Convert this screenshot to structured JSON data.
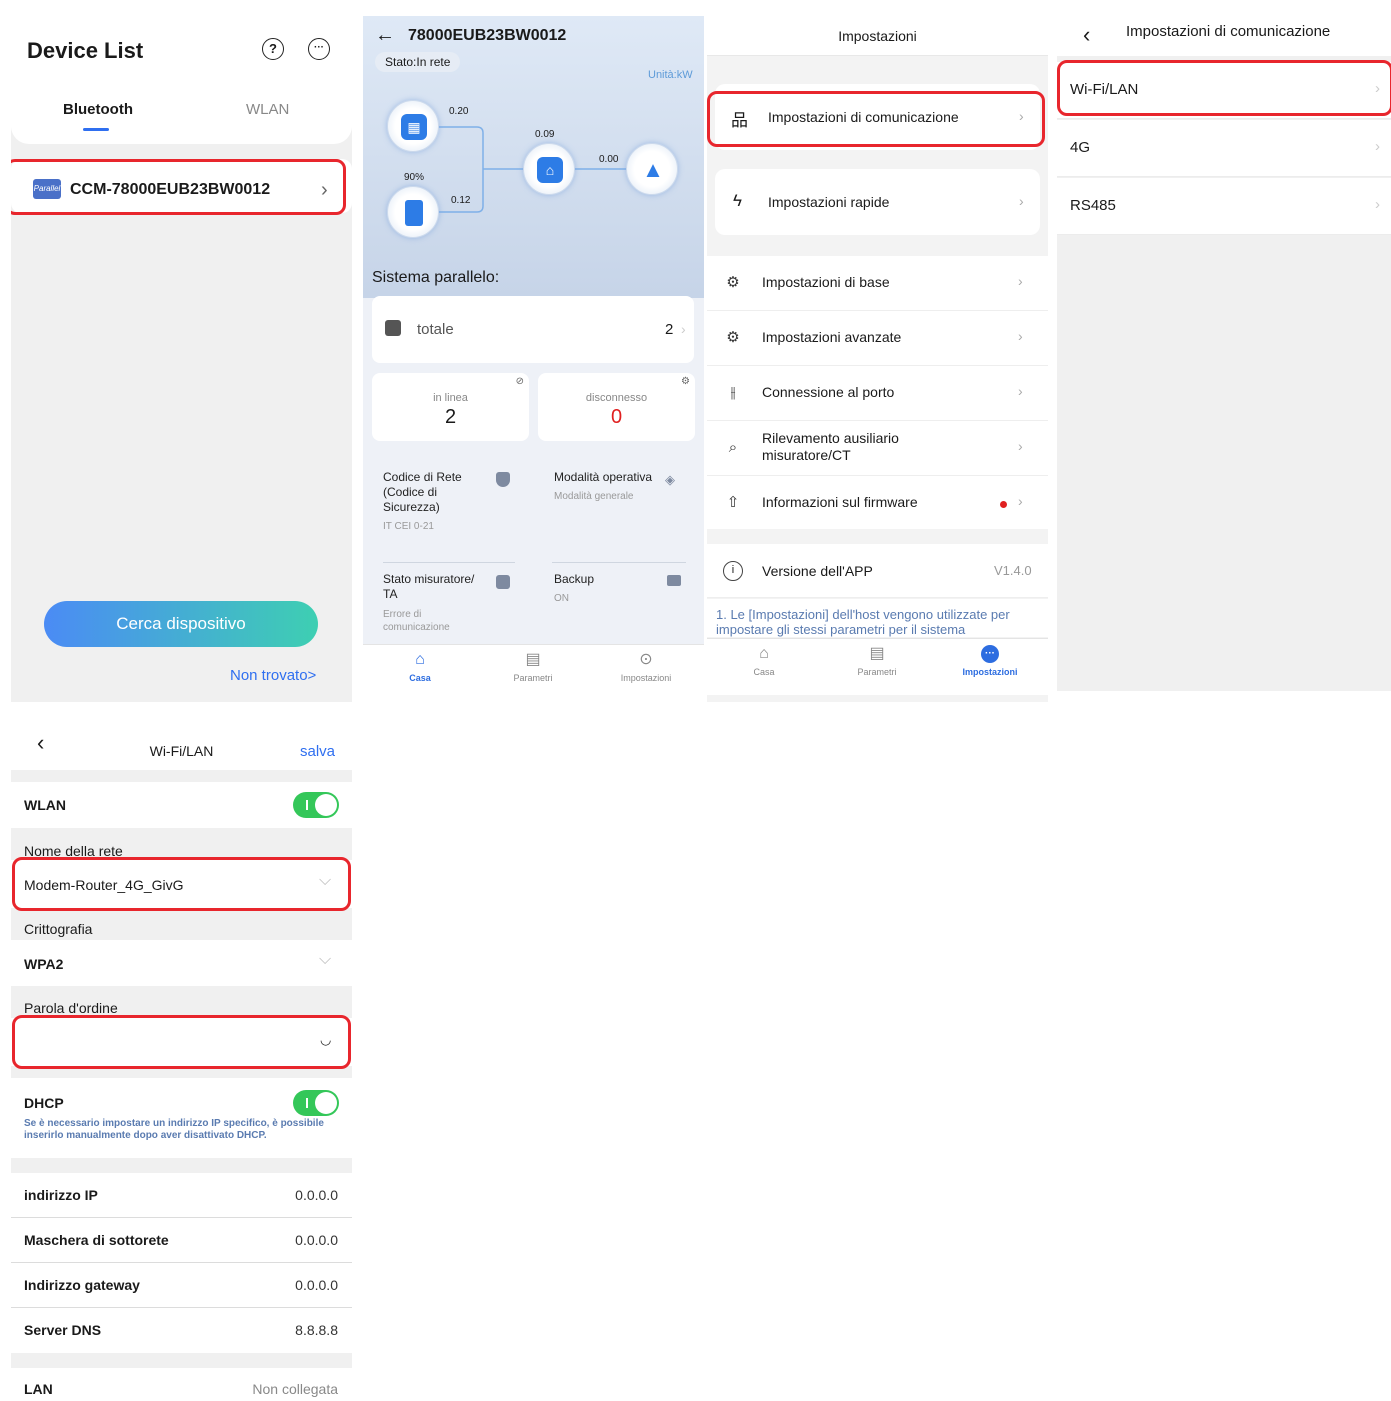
{
  "panel1": {
    "title": "Device List",
    "help_icon": "?",
    "more_icon": "···",
    "tabs": [
      "Bluetooth",
      "WLAN"
    ],
    "active_tab": "Bluetooth",
    "device": {
      "icon_text": "Parallel",
      "name": "CCM-78000EUB23BW0012"
    },
    "search_button": "Cerca dispositivo",
    "not_found": "Non trovato>"
  },
  "panel2": {
    "serial": "78000EUB23BW0012",
    "status": "Stato:In rete",
    "unit": "Unità:kW",
    "flow": {
      "pv": "0.20",
      "battery_soc": "90%",
      "battery": "0.12",
      "home": "0.09",
      "grid": "0.00"
    },
    "section_title": "Sistema parallelo:",
    "total": {
      "label": "totale",
      "value": "2"
    },
    "online": {
      "label": "in linea",
      "value": "2"
    },
    "offline": {
      "label": "disconnesso",
      "value": "0"
    },
    "info": [
      {
        "title": "Codice di Rete (Codice di Sicurezza)",
        "sub": "IT CEI 0-21"
      },
      {
        "title": "Modalità operativa",
        "sub": "Modalità generale"
      },
      {
        "title": "Stato misuratore/ TA",
        "sub": "Errore di comunicazione"
      },
      {
        "title": "Backup",
        "sub": "ON"
      }
    ],
    "nav": [
      "Casa",
      "Parametri",
      "Impostazioni"
    ]
  },
  "panel3": {
    "title": "Impostazioni",
    "cards": [
      "Impostazioni di comunicazione",
      "Impostazioni rapide"
    ],
    "items": [
      "Impostazioni di base",
      "Impostazioni avanzate",
      "Connessione al porto",
      "Rilevamento ausiliario misuratore/CT",
      "Informazioni sul firmware"
    ],
    "app_version": {
      "label": "Versione dell'APP",
      "value": "V1.4.0"
    },
    "note": "1. Le [Impostazioni] dell'host vengono utilizzate per impostare gli stessi parametri per il sistema",
    "nav": [
      "Casa",
      "Parametri",
      "Impostazioni"
    ]
  },
  "panel4": {
    "title": "Impostazioni di comunicazione",
    "items": [
      "Wi-Fi/LAN",
      "4G",
      "RS485"
    ]
  },
  "panel5": {
    "title": "Wi-Fi/LAN",
    "save": "salva",
    "wlan_label": "WLAN",
    "network_name_label": "Nome della rete",
    "network_name_value": "Modem-Router_4G_GivG",
    "encryption_label": "Crittografia",
    "encryption_value": "WPA2",
    "password_label": "Parola d'ordine",
    "password_value": "",
    "dhcp_label": "DHCP",
    "dhcp_note": "Se è necessario impostare un indirizzo IP specifico, è possibile inserirlo manualmente dopo aver disattivato DHCP.",
    "fields": [
      {
        "label": "indirizzo IP",
        "value": "0.0.0.0"
      },
      {
        "label": "Maschera di sottorete",
        "value": "0.0.0.0"
      },
      {
        "label": "Indirizzo gateway",
        "value": "0.0.0.0"
      },
      {
        "label": "Server DNS",
        "value": "8.8.8.8"
      }
    ],
    "lan": {
      "label": "LAN",
      "value": "Non collegata"
    }
  },
  "colors": {
    "accent": "#2f6ff0",
    "highlight": "#e8262d",
    "toggle_on": "#34c759",
    "alert": "#e02020"
  }
}
